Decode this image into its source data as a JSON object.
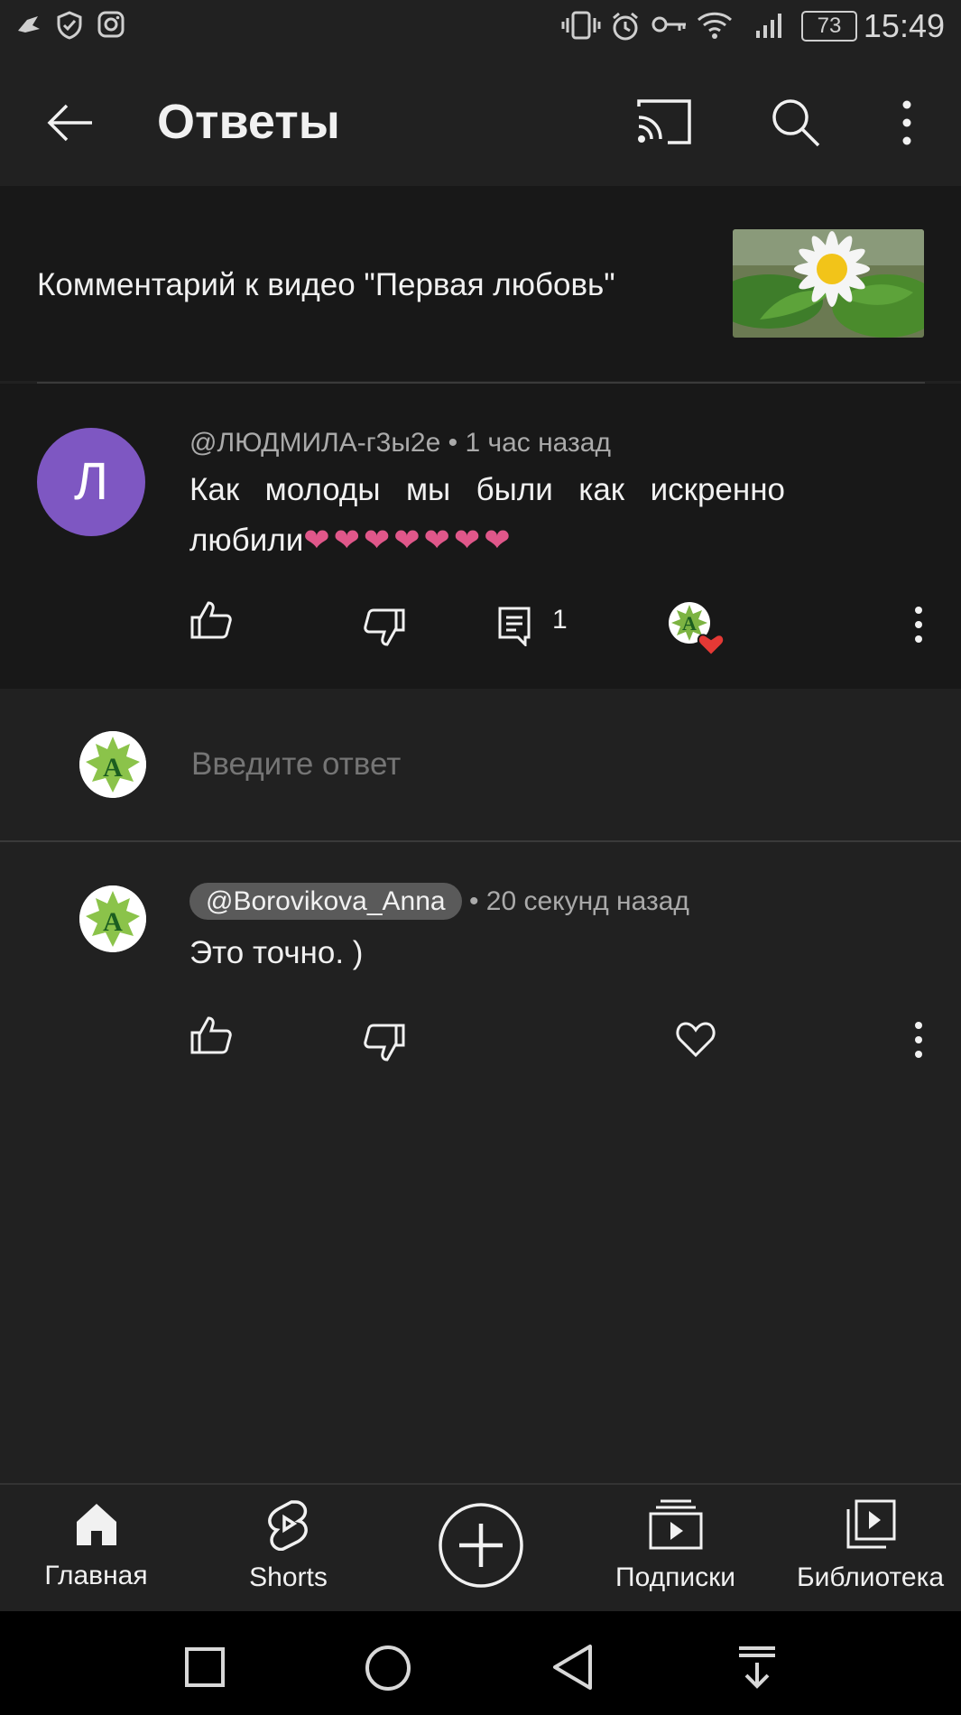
{
  "status_bar": {
    "time": "15:49",
    "battery": "73",
    "left_icons": [
      "bird-icon",
      "shield-check-icon",
      "instagram-icon"
    ],
    "right_icons": [
      "vibrate-icon",
      "alarm-icon",
      "key-icon",
      "wifi-icon",
      "signal-icon",
      "battery-icon"
    ]
  },
  "app_bar": {
    "title": "Ответы",
    "actions": [
      "cast-icon",
      "search-icon",
      "more-vert-icon"
    ]
  },
  "video_header": {
    "caption": "Комментарий к видео \"Первая любовь\""
  },
  "parent_comment": {
    "avatar_letter": "Л",
    "author": "@ЛЮДМИЛА-г3ы2е",
    "time": "1 час назад",
    "text": "Как молоды мы были как искренно любили",
    "hearts": "❤❤❤❤❤❤❤",
    "reply_count": "1"
  },
  "reply_box": {
    "placeholder": "Введите ответ"
  },
  "reply": {
    "author": "@Borovikova_Anna",
    "time": "20 секунд назад",
    "text": "Это точно. )"
  },
  "bottom_nav": {
    "items": [
      {
        "label": "Главная",
        "icon": "home-icon"
      },
      {
        "label": "Shorts",
        "icon": "shorts-icon"
      },
      {
        "label": "",
        "icon": "create-icon"
      },
      {
        "label": "Подписки",
        "icon": "subscriptions-icon"
      },
      {
        "label": "Библиотека",
        "icon": "library-icon"
      }
    ]
  },
  "system_nav": [
    "recents-icon",
    "home-circle-icon",
    "back-triangle-icon",
    "notifications-pull-icon"
  ],
  "colors": {
    "background": "#212121",
    "section_bg": "#181818",
    "avatar_purple": "#7e57c2",
    "heart_pink": "#e0578a",
    "heart_red": "#e53935"
  }
}
